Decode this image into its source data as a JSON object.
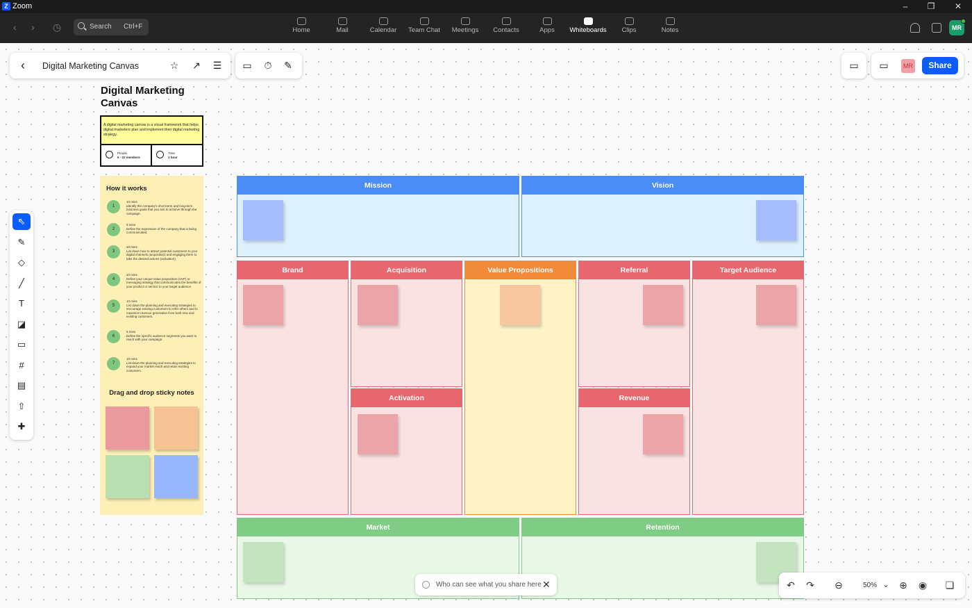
{
  "window": {
    "app_title": "Zoom",
    "logo_letter": "Z",
    "minimize": "–",
    "maximize": "❐",
    "close": "✕"
  },
  "topnav": {
    "back": "‹",
    "forward": "›",
    "history": "◷",
    "search": {
      "label": "Search",
      "shortcut": "Ctrl+F"
    },
    "items": [
      {
        "label": "Home",
        "icon": "home-icon"
      },
      {
        "label": "Mail",
        "icon": "mail-icon"
      },
      {
        "label": "Calendar",
        "icon": "calendar-icon"
      },
      {
        "label": "Team Chat",
        "icon": "chat-icon"
      },
      {
        "label": "Meetings",
        "icon": "video-icon"
      },
      {
        "label": "Contacts",
        "icon": "contacts-icon"
      },
      {
        "label": "Apps",
        "icon": "apps-icon"
      },
      {
        "label": "Whiteboards",
        "icon": "whiteboard-icon",
        "active": true
      },
      {
        "label": "Clips",
        "icon": "clips-icon"
      },
      {
        "label": "Notes",
        "icon": "notes-icon"
      }
    ],
    "avatar_initials": "MR"
  },
  "board": {
    "title": "Digital Marketing Canvas",
    "back": "‹",
    "star": "☆",
    "open_external": "↗",
    "menu": "☰",
    "present": "▭",
    "timer": "⏱",
    "signature": "✎",
    "comment": "▭",
    "video": "▭",
    "collaborator_initials": "MR",
    "share_label": "Share"
  },
  "tools": [
    {
      "name": "select-tool",
      "icon": "⇖",
      "active": true
    },
    {
      "name": "pen-tool",
      "icon": "✎"
    },
    {
      "name": "shapes-tool",
      "icon": "◇"
    },
    {
      "name": "line-tool",
      "icon": "╱"
    },
    {
      "name": "text-tool",
      "icon": "T"
    },
    {
      "name": "sticky-note-tool",
      "icon": "◪"
    },
    {
      "name": "comment-tool",
      "icon": "▭"
    },
    {
      "name": "frame-tool",
      "icon": "#"
    },
    {
      "name": "template-tool",
      "icon": "▤"
    },
    {
      "name": "upload-tool",
      "icon": "⇧"
    },
    {
      "name": "more-tools",
      "icon": "✚"
    }
  ],
  "template": {
    "title": "Digital Marketing Canvas",
    "description": "A digital marketing canvas is a visual framework that helps digital marketers plan and implement their digital marketing strategy.",
    "people_label": "People",
    "people_value": "5 - 10 members",
    "time_label": "Time",
    "time_value": "1 hour",
    "how_title": "How it works",
    "steps": [
      {
        "num": "1",
        "dur": "10 mins",
        "text": "Identify the company's short-term and long-term business goals that you aim to achieve through the campaign."
      },
      {
        "num": "2",
        "dur": "5 mins",
        "text": "Define the expression of the company that is being communicated."
      },
      {
        "num": "3",
        "dur": "10 mins",
        "text": "List down how to attract potential customers to your digital channels (acquisition) and engaging them to take the desired actions (activation)."
      },
      {
        "num": "4",
        "dur": "10 mins",
        "text": "Define your unique value proposition (UVP) or messaging strategy that communicates the benefits of your product or service to your target audience."
      },
      {
        "num": "5",
        "dur": "10 mins",
        "text": "List down the planning and executing strategies to encourage existing customers to refer others and to maximize revenue generation from both new and existing customers."
      },
      {
        "num": "6",
        "dur": "5 mins",
        "text": "Define the specific audience segments you want to reach with your campaign."
      },
      {
        "num": "7",
        "dur": "10 mins",
        "text": "List down the planning and executing strategies to expand your market reach and retain existing customers."
      }
    ],
    "drag_title": "Drag and drop sticky notes",
    "sticky_colors": [
      "#ea9a9e",
      "#f6c193",
      "#badfb2",
      "#98b7fb"
    ]
  },
  "sections": {
    "mission": "Mission",
    "vision": "Vision",
    "brand": "Brand",
    "acquisition": "Acquisition",
    "value_propositions": "Value Propositions",
    "referral": "Referral",
    "target_audience": "Target Audience",
    "activation": "Activation",
    "revenue": "Revenue",
    "market": "Market",
    "retention": "Retention"
  },
  "colors": {
    "brand_blue": "#0b5cff",
    "blue_header": "#4b8df7",
    "red_header": "#e6676e",
    "orange_header": "#f28a3c",
    "green_header": "#7fcc85"
  },
  "share_hint": {
    "text": "Who can see what you share here",
    "close": "✕"
  },
  "zoom": {
    "undo": "↶",
    "redo": "↷",
    "zoom_out": "⊖",
    "level": "50%",
    "caret": "⌄",
    "zoom_in": "⊕",
    "locate": "◉",
    "minimap": "❏"
  }
}
